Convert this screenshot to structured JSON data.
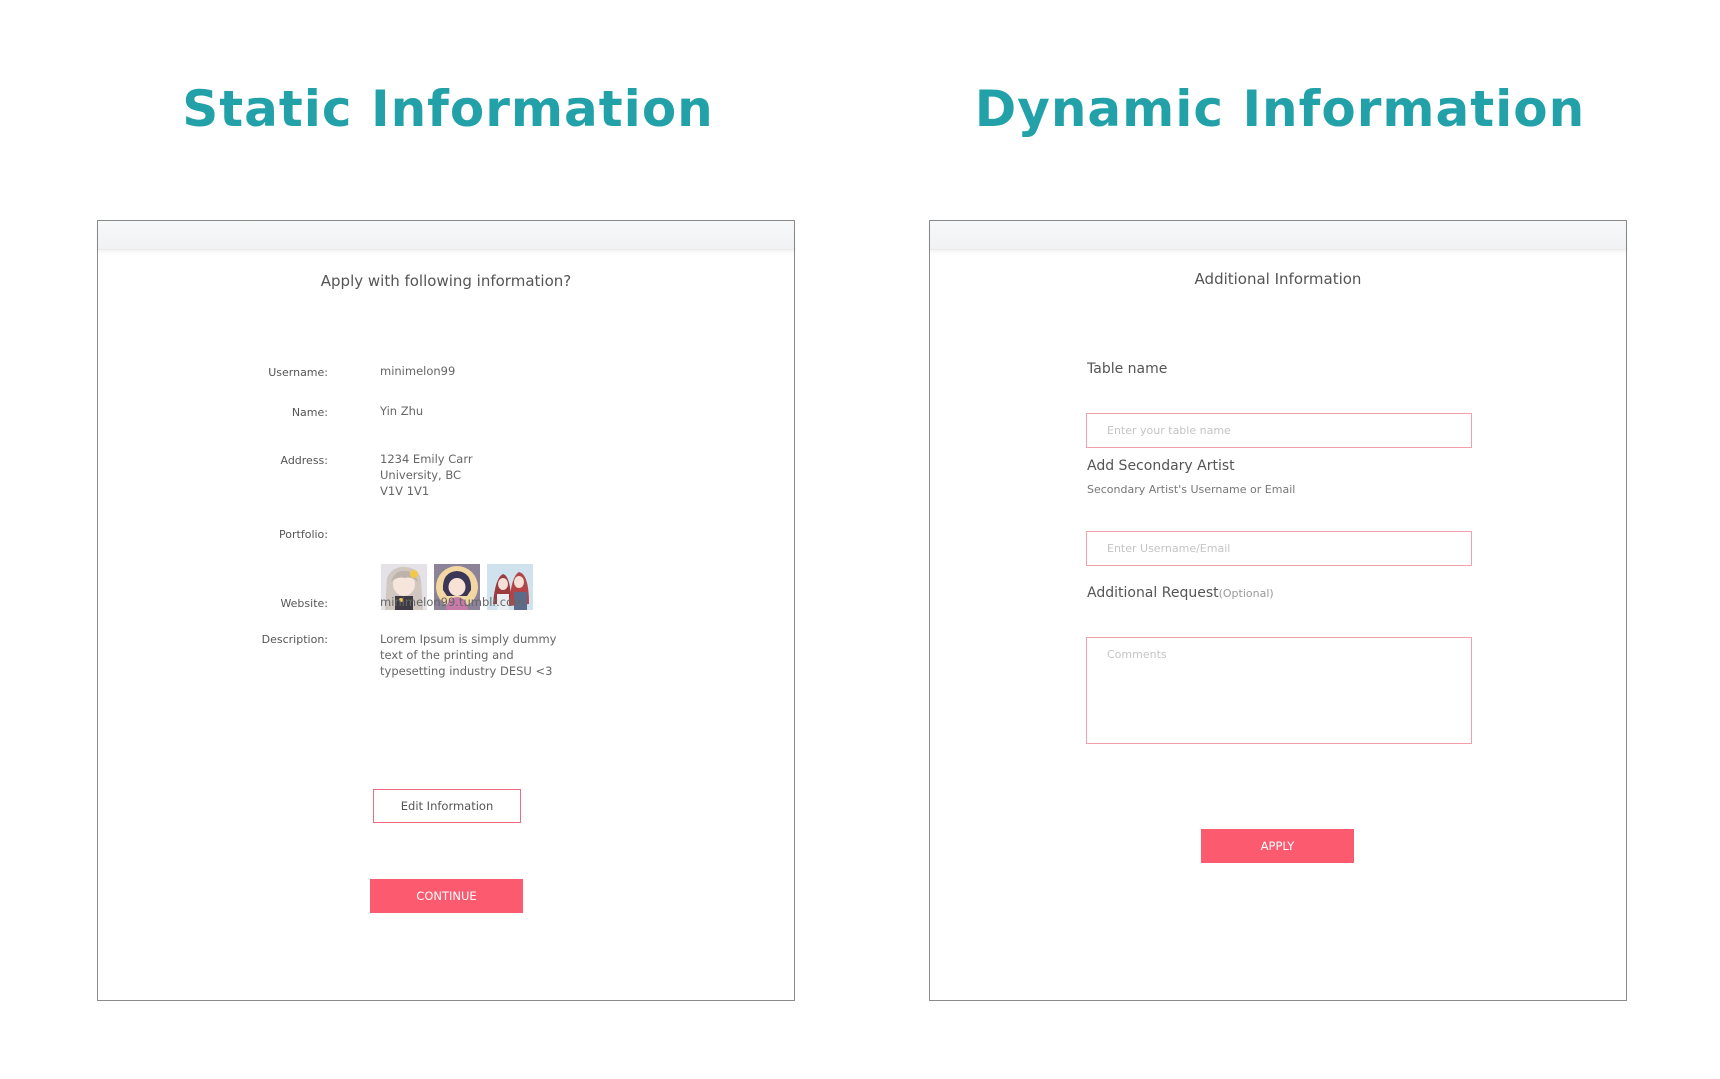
{
  "titles": {
    "static": "Static Information",
    "dynamic": "Dynamic Information"
  },
  "static_panel": {
    "heading": "Apply with following information?",
    "fields": {
      "username": {
        "label": "Username:",
        "value": "minimelon99"
      },
      "name": {
        "label": "Name:",
        "value": "Yin Zhu"
      },
      "address": {
        "label": "Address:",
        "lines": [
          "1234 Emily Carr",
          "University, BC",
          "V1V 1V1"
        ]
      },
      "portfolio": {
        "label": "Portfolio:"
      },
      "website": {
        "label": "Website:",
        "value": "minimelon99.tumblr.com"
      },
      "description": {
        "label": "Description:",
        "lines": [
          "Lorem Ipsum is simply dummy",
          "text of the printing and",
          "typesetting industry DESU <3"
        ]
      }
    },
    "edit_button": "Edit Information",
    "continue_button": "CONTINUE"
  },
  "dynamic_panel": {
    "heading": "Additional Information",
    "table_name": {
      "label": "Table name",
      "placeholder": "Enter your table name",
      "value": ""
    },
    "secondary_artist": {
      "label": "Add Secondary Artist",
      "sublabel": "Secondary Artist's Username or Email",
      "placeholder": "Enter Username/Email",
      "value": ""
    },
    "additional_request": {
      "label": "Additional Request",
      "optional": "(Optional)",
      "placeholder": "Comments",
      "value": ""
    },
    "apply_button": "APPLY"
  },
  "colors": {
    "title_teal": "#22a2a8",
    "accent_pink": "#fb5a6f",
    "input_border": "#f2a0aa"
  }
}
